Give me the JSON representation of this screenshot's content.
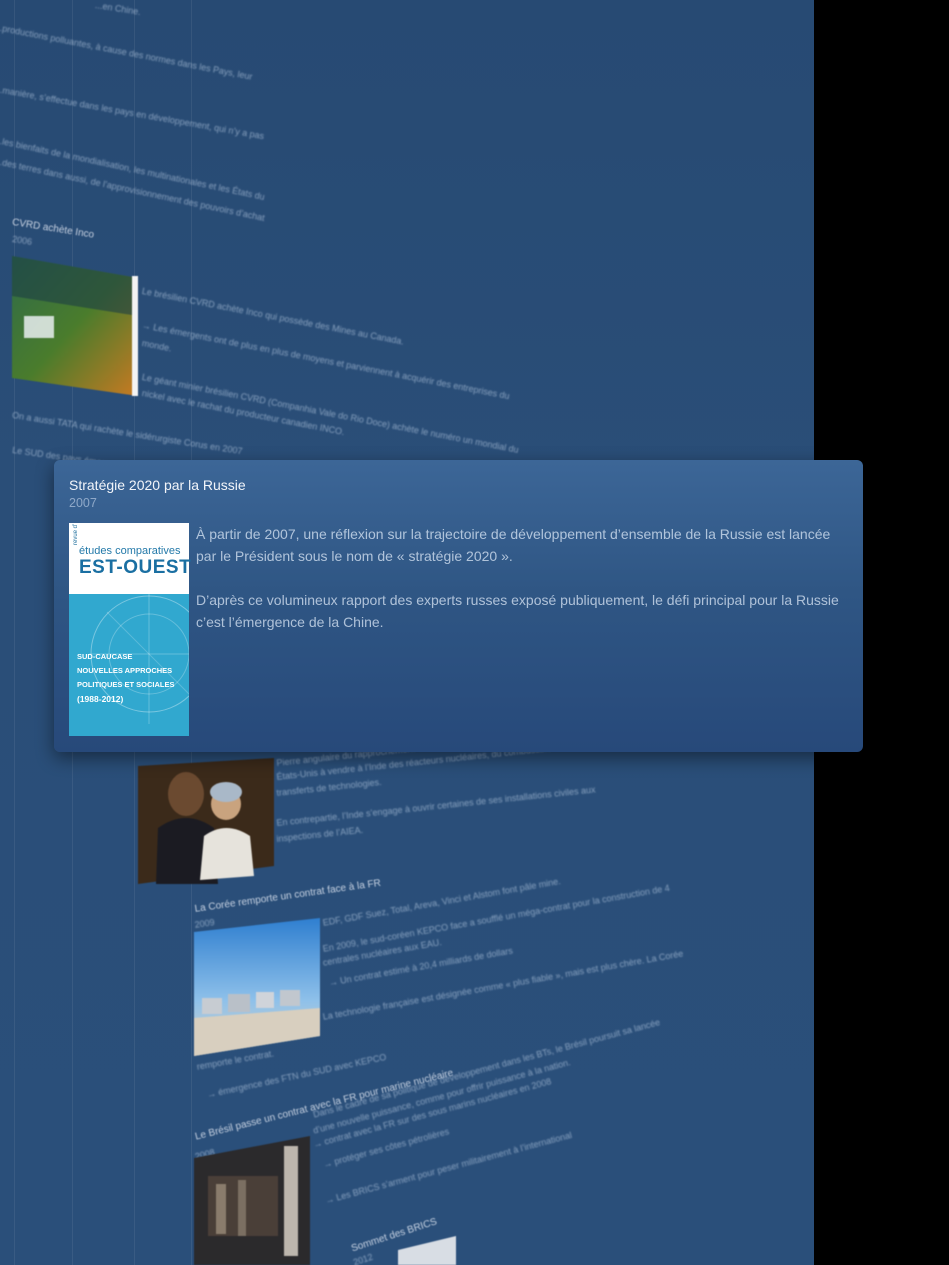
{
  "card": {
    "title": "Stratégie 2020 par la Russie",
    "year": "2007",
    "paragraphs": [
      "À partir de 2007, une réflexion sur la trajectoire de développement d’ensemble de la Russie est lancée par le Président sous le nom de « stratégie 2020 ».",
      "D’après ce volumineux rapport des experts russes exposé publiquement, le défi principal pour la Russie c’est l’émergence de la Chine."
    ],
    "cover": {
      "revue": "revue d’",
      "etudes": "études comparatives",
      "est_ouest": "EST-OUEST",
      "sub1": "SUD-CAUCASE",
      "sub2": "NOUVELLES APPROCHES",
      "sub3": "POLITIQUES ET SOCIALES",
      "sub4": "(1988-2012)"
    }
  },
  "background": {
    "lines_top": [
      "...en Chine.",
      "...productions polluantes, à cause des normes dans les Pays, leur",
      "...manière, s’effectue dans les pays en développement, qui n’y a pas",
      "...les bienfaits de la mondialisation, les multinationales et les États du",
      "...des terres dans aussi, de l’approvisionnement des pouvoirs d’achat"
    ],
    "cvrd_title": "CVRD achète Inco",
    "cvrd_year": "2006",
    "cvrd_lines": [
      "Le brésilien CVRD achète Inco qui possède des Mines au Canada.",
      "→ Les émergents ont de plus en plus de moyens et parviennent à acquérir des entreprises du",
      "monde.",
      "Le géant minier brésilien CVRD (Companhia Vale do Rio Doce) achète le numéro un mondial du",
      "nickel avec le rachat du producteur canadien INCO."
    ],
    "tata_line": "On a aussi TATA qui rachète le sidérurgiste Corus en 2007",
    "suite_line": "Le SUD des pays émergents...",
    "obama_lines": [
      "Pierre angulaire du rapprochement entre les deux puissances...",
      "États-Unis à vendre à l’Inde des réacteurs nucléaires, du combustible à usage civil et des",
      "transferts de technologies.",
      "En contrepartie, l’Inde s’engage à ouvrir certaines de ses installations civiles aux",
      "inspections de l’AIEA."
    ],
    "coree_title": "La Corée remporte un contrat face à la FR",
    "coree_year": "2009",
    "coree_lines": [
      "EDF, GDF Suez, Total, Areva, Vinci et Alstom font pâle mine.",
      "En 2009, le sud-coréen KEPCO face a soufflé un méga-contrat pour la construction de 4",
      "centrales nucléaires aux EAU.",
      "→ Un contrat estimé à 20,4 milliards de dollars",
      "La technologie française est désignée comme « plus fiable », mais est plus chère. La Corée"
    ],
    "remporte_line": "remporte le contrat.",
    "emergence_line": "→ émergence des FTN du SUD avec KEPCO",
    "bresil_title": "Le Brésil passe un contrat avec la FR pour marine nucléaire",
    "bresil_year": "2008",
    "bresil_lines": [
      "Dans le cadre de sa politique de développement dans les BTs, le Brésil poursuit sa lancée",
      "d’une nouvelle puissance, comme pour offrir puissance à la nation.",
      "→ contrat avec la FR sur des sous marins nucléaires en 2008",
      "→ protéger ses côtes pétrolières",
      "→ Les BRICS s’arment pour peser militairement à l’international"
    ],
    "brics_title": "Sommet des BRICS",
    "brics_year": "2012"
  }
}
